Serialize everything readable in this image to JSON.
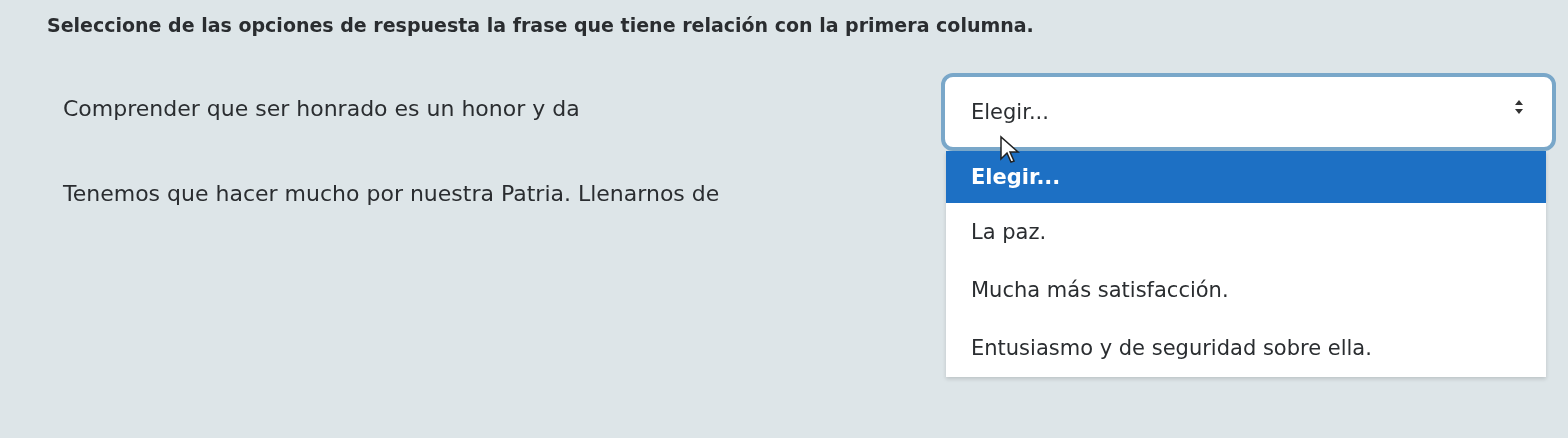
{
  "instruction": "Seleccione de las opciones de respuesta la frase que tiene relación con la primera columna.",
  "rows": [
    {
      "label": "Comprender que ser honrado es un honor y da",
      "select": {
        "value": "Elegir...",
        "focused": true
      }
    },
    {
      "label": "Tenemos que hacer mucho por nuestra Patria. Llenarnos de"
    }
  ],
  "dropdown": {
    "options": [
      {
        "label": "Elegir...",
        "selected": true
      },
      {
        "label": "La paz.",
        "selected": false
      },
      {
        "label": "Mucha más satisfacción.",
        "selected": false
      },
      {
        "label": "Entusiasmo y de seguridad sobre ella.",
        "selected": false
      }
    ]
  }
}
